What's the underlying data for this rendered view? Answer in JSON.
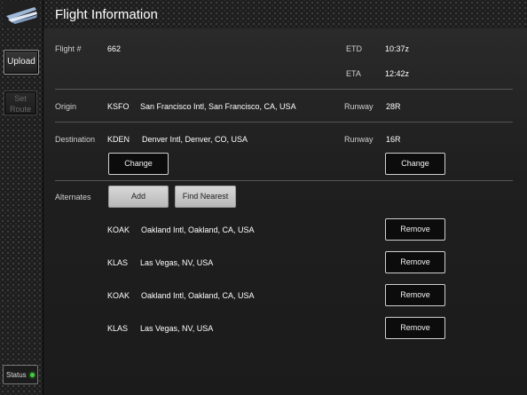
{
  "app": {
    "title": "Flight Information"
  },
  "sidebar": {
    "upload_label": "Upload",
    "set_route_line1": "Set",
    "set_route_line2": "Route",
    "status_label": "Status",
    "status_color": "#3bd23b"
  },
  "flight": {
    "label": "Flight #",
    "number": "662"
  },
  "times": {
    "etd_label": "ETD",
    "etd": "10:37z",
    "eta_label": "ETA",
    "eta": "12:42z"
  },
  "origin": {
    "label": "Origin",
    "code": "KSFO",
    "name": "San Francisco Intl, San Francisco, CA, USA",
    "runway_label": "Runway",
    "runway": "28R"
  },
  "destination": {
    "label": "Destination",
    "code": "KDEN",
    "name": "Denver Intl, Denver, CO, USA",
    "runway_label": "Runway",
    "runway": "16R",
    "change_label": "Change",
    "runway_change_label": "Change"
  },
  "alternates": {
    "label": "Alternates",
    "add_label": "Add",
    "find_nearest_label": "Find Nearest",
    "remove_label": "Remove",
    "items": [
      {
        "code": "KOAK",
        "name": "Oakland Intl, Oakland, CA, USA"
      },
      {
        "code": "KLAS",
        "name": "Las Vegas, NV, USA"
      },
      {
        "code": "KOAK",
        "name": "Oakland Intl, Oakland, CA, USA"
      },
      {
        "code": "KLAS",
        "name": "Las Vegas, NV, USA"
      }
    ]
  }
}
